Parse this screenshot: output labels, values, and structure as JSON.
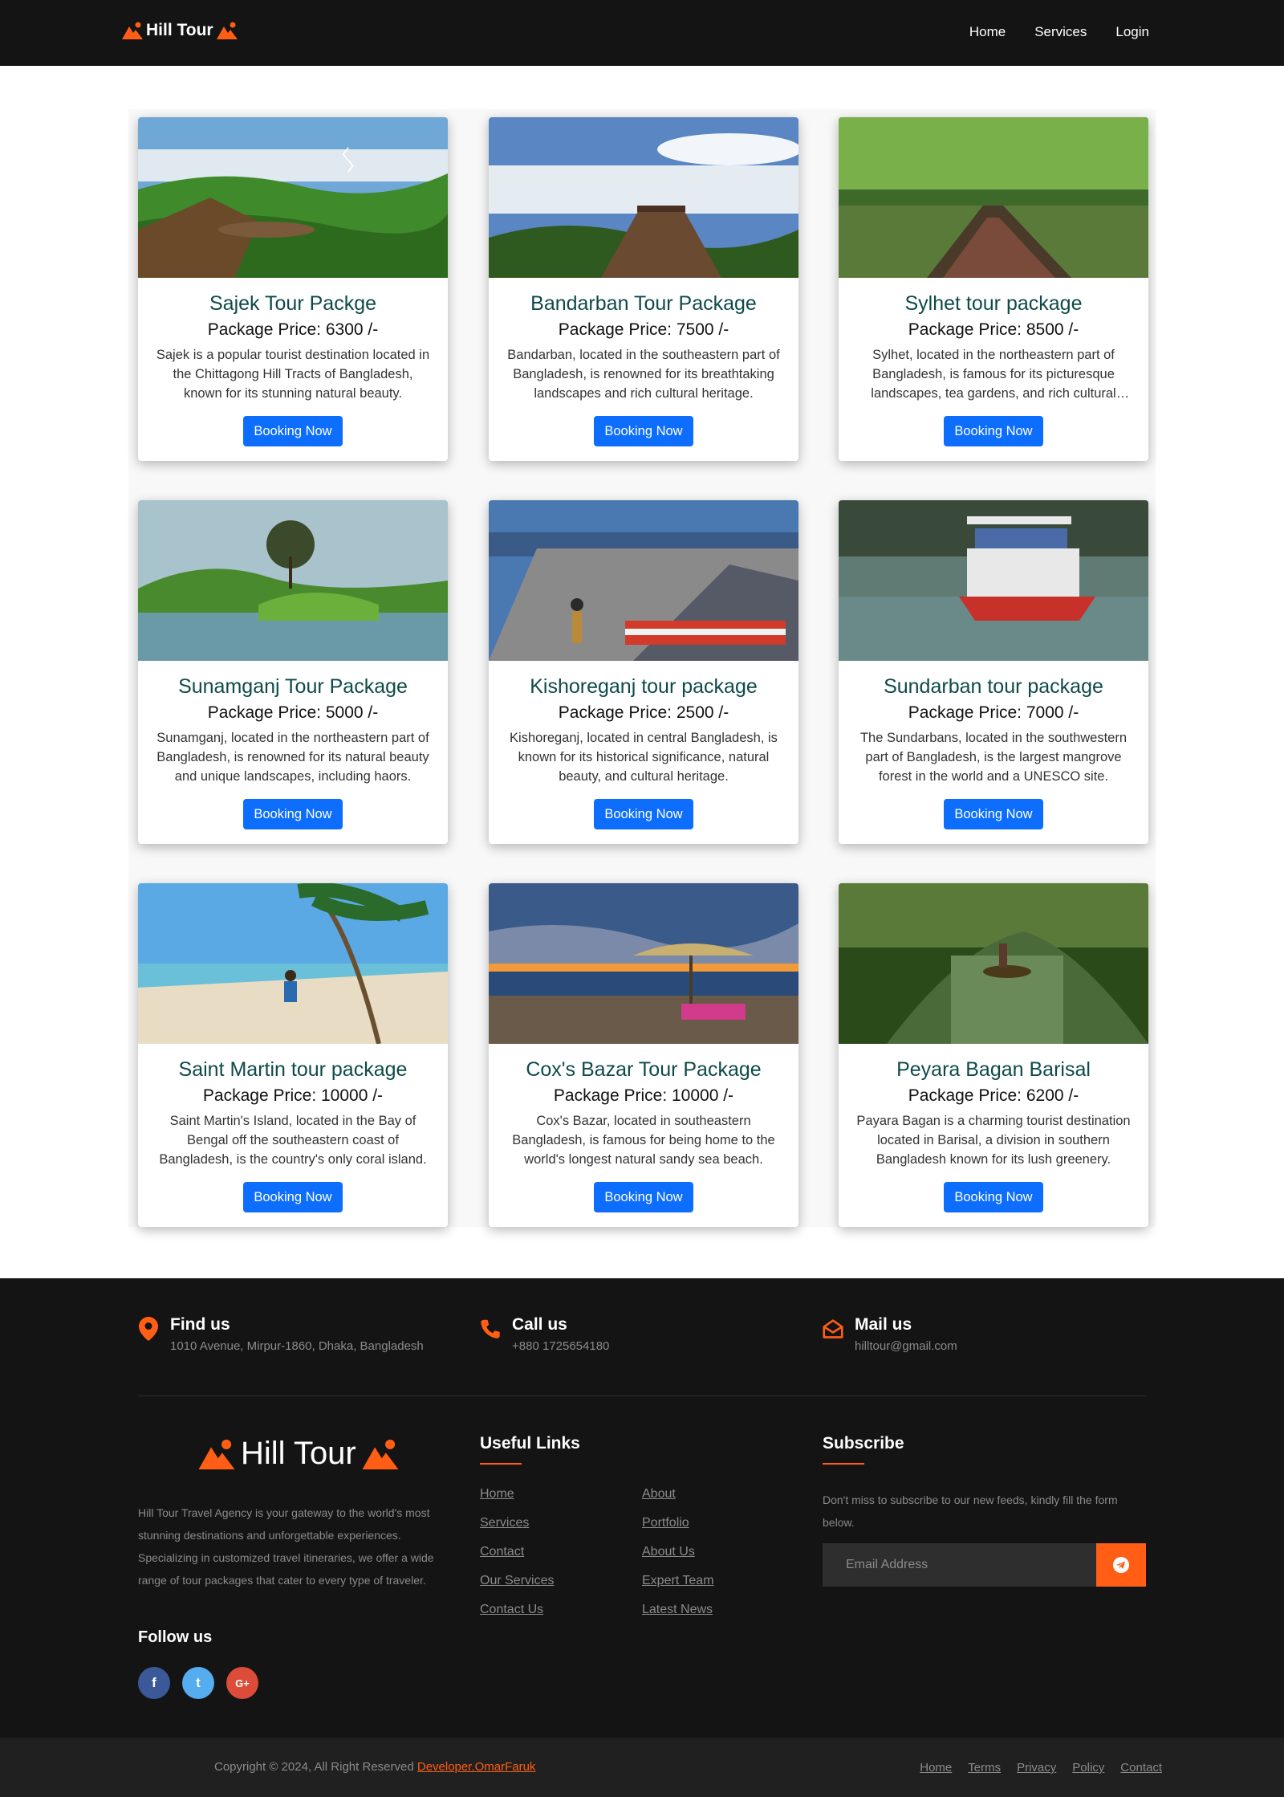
{
  "nav": {
    "brand": "Hill Tour",
    "links": [
      "Home",
      "Services",
      "Login"
    ]
  },
  "cards": [
    {
      "title": "Sajek Tour Packge",
      "price": "Package Price: 6300 /-",
      "desc": "Sajek is a popular tourist destination located in the Chittagong Hill Tracts of Bangladesh, known for its stunning natural beauty.",
      "button": "Booking Now",
      "scene": "sajek"
    },
    {
      "title": "Bandarban Tour Package",
      "price": "Package Price: 7500 /-",
      "desc": "Bandarban, located in the southeastern part of Bangladesh, is renowned for its breathtaking landscapes and rich cultural heritage.",
      "button": "Booking Now",
      "scene": "bandarban"
    },
    {
      "title": "Sylhet tour package",
      "price": "Package Price: 8500 /-",
      "desc": "Sylhet, located in the northeastern part of Bangladesh, is famous for its picturesque landscapes, tea gardens, and rich cultural heritage.",
      "button": "Booking Now",
      "scene": "sylhet"
    },
    {
      "title": "Sunamganj Tour Package",
      "price": "Package Price: 5000 /-",
      "desc": "Sunamganj, located in the northeastern part of Bangladesh, is renowned for its natural beauty and unique landscapes, including haors.",
      "button": "Booking Now",
      "scene": "sunamganj"
    },
    {
      "title": "Kishoreganj tour package",
      "price": "Package Price: 2500 /-",
      "desc": "Kishoreganj, located in central Bangladesh, is known for its historical significance, natural beauty, and cultural heritage.",
      "button": "Booking Now",
      "scene": "kishoreganj"
    },
    {
      "title": "Sundarban tour package",
      "price": "Package Price: 7000 /-",
      "desc": "The Sundarbans, located in the southwestern part of Bangladesh, is the largest mangrove forest in the world and a UNESCO site.",
      "button": "Booking Now",
      "scene": "sundarban"
    },
    {
      "title": "Saint Martin tour package",
      "price": "Package Price: 10000 /-",
      "desc": "Saint Martin's Island, located in the Bay of Bengal off the southeastern coast of Bangladesh, is the country's only coral island.",
      "button": "Booking Now",
      "scene": "saintmartin"
    },
    {
      "title": "Cox's Bazar Tour Package",
      "price": "Package Price: 10000 /-",
      "desc": "Cox's Bazar, located in southeastern Bangladesh, is famous for being home to the world's longest natural sandy sea beach.",
      "button": "Booking Now",
      "scene": "coxsbazar"
    },
    {
      "title": "Peyara Bagan Barisal",
      "price": "Package Price: 6200 /-",
      "desc": "Payara Bagan is a charming tourist destination located in Barisal, a division in southern Bangladesh known for its lush greenery.",
      "button": "Booking Now",
      "scene": "peyara"
    }
  ],
  "footer": {
    "contacts": [
      {
        "title": "Find us",
        "text": "1010 Avenue, Mirpur-1860, Dhaka, Bangladesh",
        "icon": "map-pin-icon"
      },
      {
        "title": "Call us",
        "text": "+880 1725654180",
        "icon": "phone-icon"
      },
      {
        "title": "Mail us",
        "text": "hilltour@gmail.com",
        "icon": "envelope-open-icon"
      }
    ],
    "brand": "Hill Tour",
    "about": "Hill Tour Travel Agency is your gateway to the world's most stunning destinations and unforgettable experiences. Specializing in customized travel itineraries, we offer a wide range of tour packages that cater to every type of traveler.",
    "follow_title": "Follow us",
    "social": [
      {
        "label": "f",
        "color": "#3b5998",
        "icon": "facebook-icon"
      },
      {
        "label": "t",
        "color": "#55acee",
        "icon": "twitter-icon"
      },
      {
        "label": "G+",
        "color": "#dd4b39",
        "icon": "google-plus-icon"
      }
    ],
    "useful_title": "Useful Links",
    "links_col1": [
      "Home",
      "Services",
      "Contact",
      "Our Services",
      "Contact Us"
    ],
    "links_col2": [
      "About",
      "Portfolio",
      "About Us",
      "Expert Team",
      "Latest News"
    ],
    "subscribe_title": "Subscribe",
    "subscribe_text": "Don't miss to subscribe to our new feeds, kindly fill the form below.",
    "email_placeholder": "Email Address",
    "send_icon": "telegram-send-icon"
  },
  "bottom": {
    "copyright": "Copyright © 2024, All Right Reserved",
    "developer": "Developer.OmarFaruk",
    "links": [
      "Home",
      "Terms",
      "Privacy",
      "Policy",
      "Contact"
    ]
  },
  "colors": {
    "accent": "#ff5e14",
    "button": "#0d6efd",
    "title": "#0f4a4a",
    "dark": "#141414"
  }
}
